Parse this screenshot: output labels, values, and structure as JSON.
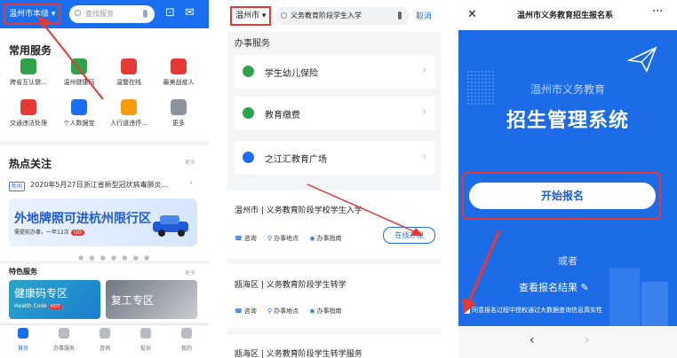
{
  "panel1": {
    "header": {
      "city": "温州市本级",
      "search_placeholder": "查找服务"
    },
    "common": {
      "title": "常用服务",
      "items": [
        {
          "label": "跨省互认健...",
          "color": "#2fa34a",
          "icon": "qr-code-icon"
        },
        {
          "label": "温州健康码",
          "color": "#2fa34a",
          "icon": "health-code-icon"
        },
        {
          "label": "温警在线",
          "color": "#e53935",
          "icon": "police-cap-icon"
        },
        {
          "label": "最美战疫人",
          "color": "#e53935",
          "icon": "heart-person-icon"
        },
        {
          "label": "交通违法处理",
          "color": "#e53935",
          "icon": "traffic-ticket-icon"
        },
        {
          "label": "个人数据宝",
          "color": "#1a6ef0",
          "icon": "data-treasure-icon"
        },
        {
          "label": "人行道违停...",
          "color": "#f39c12",
          "icon": "pedestrian-icon"
        },
        {
          "label": "更多",
          "color": "#8c939d",
          "icon": "grid-more-icon"
        }
      ]
    },
    "hot": {
      "title": "热点关注",
      "more": "更多",
      "news_tag": "新闻",
      "news": "2020年5月27日浙江省新型冠状病毒肺炎...",
      "banner_title": "外地牌照可进杭州限行区",
      "banner_sub": "需提前办事，一年12次",
      "banner_go": "GO"
    },
    "special": {
      "title": "特色服务",
      "more": "更多",
      "tile1_title": "健康码专区",
      "tile1_sub": "Health Code",
      "tile1_badge": "HOT",
      "tile2_title": "复工专区"
    },
    "tabs": [
      "首页",
      "办事服务",
      "咨询",
      "投诉",
      "我的"
    ]
  },
  "panel2": {
    "city": "温州市",
    "search_value": "义务教育阶段学生入学",
    "cancel": "取消",
    "subhead": "办事服务",
    "items": [
      {
        "label": "学生幼儿保险",
        "color": "#2fa34a"
      },
      {
        "label": "教育缴费",
        "color": "#2fa34a"
      },
      {
        "label": "之江汇教育广场",
        "color": "#1a6ef0"
      }
    ],
    "cards": [
      {
        "title": "温州市 | 义务教育阶段学校学生入学",
        "consult": "咨询",
        "place": "办事地点",
        "guide": "办事指南",
        "online": "在线办理"
      },
      {
        "title": "瓯海区 | 义务教育阶段学生转学",
        "consult": "咨询",
        "place": "办事地点",
        "guide": "办事指南"
      },
      {
        "title": "瓯海区 | 义务教育阶段学生转学服务"
      }
    ]
  },
  "panel3": {
    "title": "温州市义务教育招生报名系",
    "subtitle": "温州市义务教育",
    "main_title": "招生管理系统",
    "start_button": "开始报名",
    "or": "或者",
    "view_result": "查看报名结果",
    "agree": "同意报名过程中授权通过大数据查询信息真实性"
  }
}
